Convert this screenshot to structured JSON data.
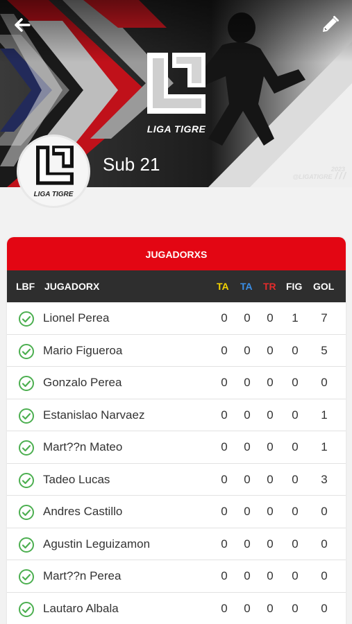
{
  "header": {
    "back_icon": "arrow-left-icon",
    "edit_icon": "pencil-icon",
    "banner_logo_text": "LIGA TIGRE",
    "watermark_year": "2023",
    "watermark_handle": "@LIGATIGRE",
    "avatar_text": "LIGA TIGRE",
    "team_name": "Sub 21"
  },
  "colors": {
    "accent_red": "#e30613",
    "header_dark": "#2e2e2e",
    "ta_yellow": "#f5d400",
    "ta_blue": "#3a8ee6",
    "tr_red": "#e52b2b",
    "check_green": "#4caf50"
  },
  "table": {
    "title": "JUGADORXS",
    "columns": {
      "lbf": "LBF",
      "player": "JUGADORX",
      "ta1": "TA",
      "ta2": "TA",
      "tr": "TR",
      "fig": "FIG",
      "gol": "GOL"
    },
    "rows": [
      {
        "name": "Lionel Perea",
        "ta1": "0",
        "ta2": "0",
        "tr": "0",
        "fig": "1",
        "gol": "7"
      },
      {
        "name": "Mario Figueroa",
        "ta1": "0",
        "ta2": "0",
        "tr": "0",
        "fig": "0",
        "gol": "5"
      },
      {
        "name": "Gonzalo Perea",
        "ta1": "0",
        "ta2": "0",
        "tr": "0",
        "fig": "0",
        "gol": "0"
      },
      {
        "name": "Estanislao Narvaez",
        "ta1": "0",
        "ta2": "0",
        "tr": "0",
        "fig": "0",
        "gol": "1"
      },
      {
        "name": "Mart??n Mateo",
        "ta1": "0",
        "ta2": "0",
        "tr": "0",
        "fig": "0",
        "gol": "1"
      },
      {
        "name": "Tadeo Lucas",
        "ta1": "0",
        "ta2": "0",
        "tr": "0",
        "fig": "0",
        "gol": "3"
      },
      {
        "name": "Andres Castillo",
        "ta1": "0",
        "ta2": "0",
        "tr": "0",
        "fig": "0",
        "gol": "0"
      },
      {
        "name": "Agustin Leguizamon",
        "ta1": "0",
        "ta2": "0",
        "tr": "0",
        "fig": "0",
        "gol": "0"
      },
      {
        "name": "Mart??n Perea",
        "ta1": "0",
        "ta2": "0",
        "tr": "0",
        "fig": "0",
        "gol": "0"
      },
      {
        "name": "Lautaro Albala",
        "ta1": "0",
        "ta2": "0",
        "tr": "0",
        "fig": "0",
        "gol": "0"
      }
    ]
  }
}
